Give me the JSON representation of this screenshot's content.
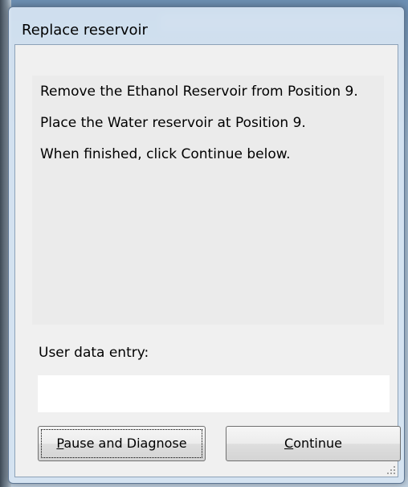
{
  "dialog": {
    "title": "Replace reservoir",
    "message_lines": [
      "Remove the Ethanol Reservoir from Position 9.",
      "Place the Water reservoir at Position 9.",
      "When finished, click Continue below."
    ],
    "user_data_label": "User data entry:",
    "user_data_value": "",
    "buttons": {
      "pause_accel": "P",
      "pause_rest": "ause and Diagnose",
      "continue_accel": "C",
      "continue_rest": "ontinue"
    }
  },
  "icons": {
    "resize_grip": "size-grip-icon"
  }
}
